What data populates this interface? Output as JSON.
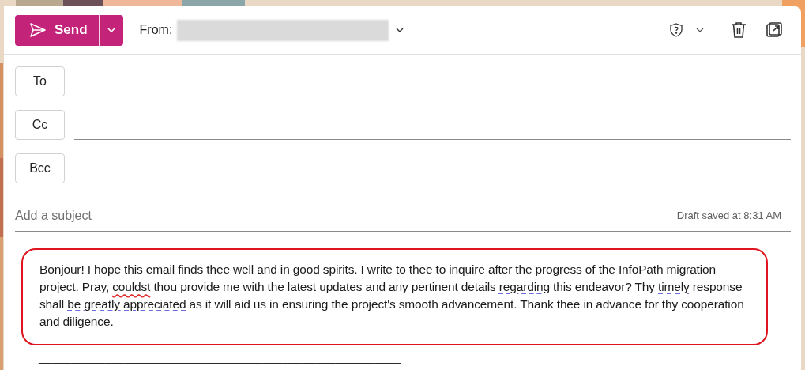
{
  "toolbar": {
    "send": {
      "label": "Send"
    },
    "from_label": "From:"
  },
  "recipients": [
    {
      "label": "To"
    },
    {
      "label": "Cc"
    },
    {
      "label": "Bcc"
    }
  ],
  "subject": {
    "placeholder": "Add a subject",
    "status": "Draft saved at 8:31 AM"
  },
  "body": {
    "segments": [
      {
        "text": "Bonjour! I hope this email finds thee well and in good spirits. I write to thee to inquire after the progress of the InfoPath migration project. Pray, ",
        "kind": "plain"
      },
      {
        "text": "couldst",
        "kind": "spelling"
      },
      {
        "text": " thou provide me with the latest updates and any pertinent details ",
        "kind": "plain"
      },
      {
        "text": "regarding",
        "kind": "grammar"
      },
      {
        "text": " this endeavor? Thy ",
        "kind": "plain"
      },
      {
        "text": "timely",
        "kind": "grammar"
      },
      {
        "text": " response shall ",
        "kind": "plain"
      },
      {
        "text": "be greatly appreciated",
        "kind": "grammar"
      },
      {
        "text": " as it will aid us in ensuring the project's smooth advancement. Thank thee in advance for thy cooperation and diligence.",
        "kind": "plain"
      }
    ],
    "signature": "_______________________________________________________"
  }
}
